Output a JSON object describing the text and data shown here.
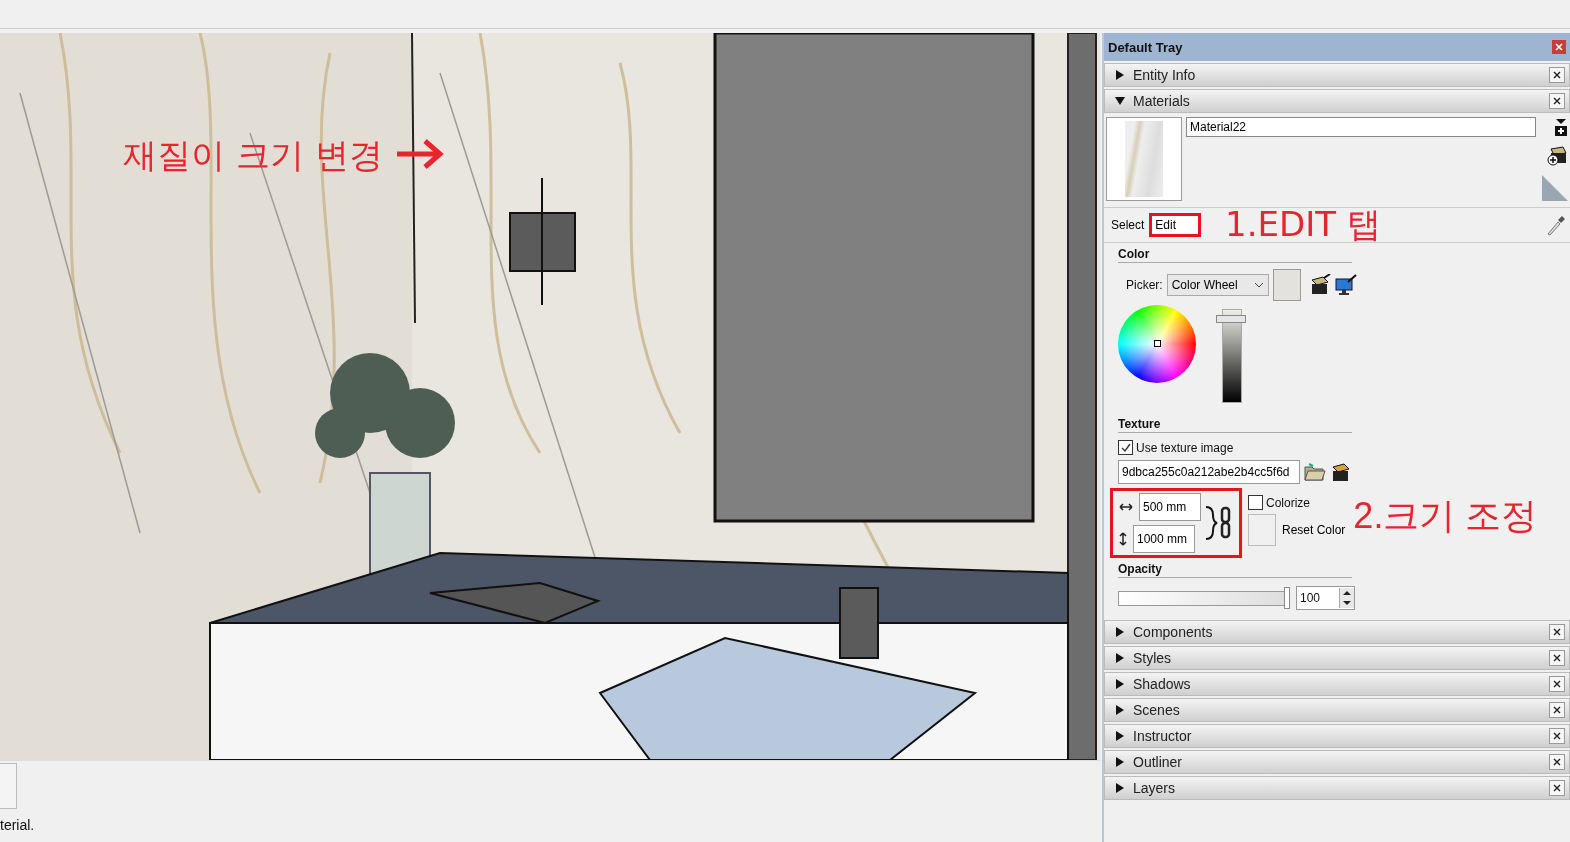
{
  "viewport": {
    "annotation": "재질이 크기 변경"
  },
  "status_bar": {
    "text": "terial."
  },
  "tray": {
    "title": "Default Tray",
    "panels": [
      {
        "title": "Entity Info",
        "expanded": false
      },
      {
        "title": "Materials",
        "expanded": true,
        "content": {
          "name": "Material22",
          "tabs": [
            {
              "label": "Select",
              "selected": false,
              "highlighted": false
            },
            {
              "label": "Edit",
              "selected": true,
              "highlighted": true
            }
          ],
          "tab_annotation": "1.EDIT 탭",
          "color_heading": "Color",
          "picker_label": "Picker:",
          "picker_value": "Color Wheel",
          "brightness": {
            "level": 0.93
          },
          "texture_heading": "Texture",
          "use_texture": {
            "label": "Use texture image",
            "checked": true
          },
          "texture_file": "9dbca255c0a212abe2b4cc5f6d",
          "size": {
            "width": "500 mm",
            "height": "1000 mm",
            "highlighted": true
          },
          "colorize": {
            "label": "Colorize",
            "checked": false
          },
          "reset_label": "Reset Color",
          "size_annotation": "2.크기 조정",
          "opacity_heading": "Opacity",
          "opacity": {
            "level": 1.0,
            "value": "100"
          }
        }
      },
      {
        "title": "Components",
        "expanded": false
      },
      {
        "title": "Styles",
        "expanded": false
      },
      {
        "title": "Shadows",
        "expanded": false
      },
      {
        "title": "Scenes",
        "expanded": false
      },
      {
        "title": "Instructor",
        "expanded": false
      },
      {
        "title": "Outliner",
        "expanded": false
      },
      {
        "title": "Layers",
        "expanded": false
      }
    ]
  }
}
